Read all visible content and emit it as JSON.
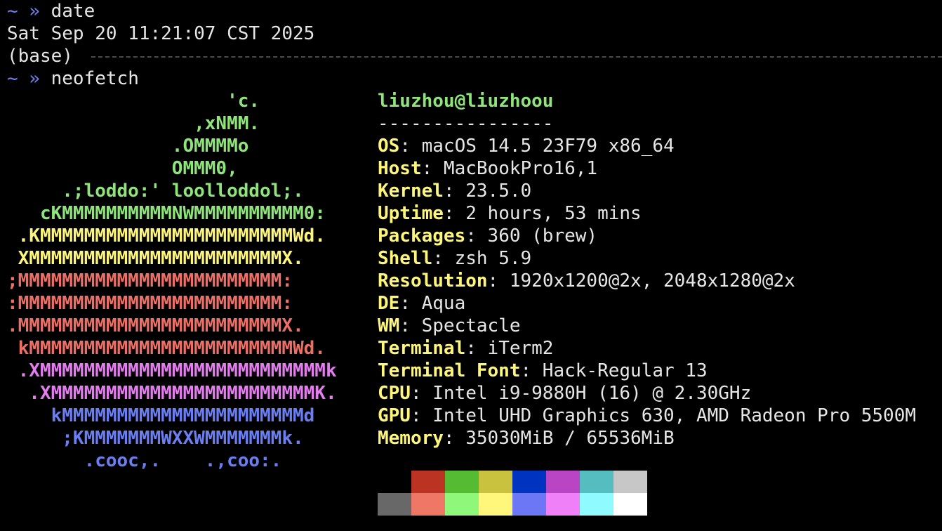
{
  "terminal": {
    "prompt_symbol": "~ »",
    "cmd1": "date",
    "date_output": "Sat Sep 20 11:21:07 CST 2025",
    "env_label": "(base)",
    "cmd2": "neofetch"
  },
  "logo_lines": [
    {
      "text": "                    'c.",
      "color": "#8ee57a"
    },
    {
      "text": "                 ,xNMM.",
      "color": "#8ee57a"
    },
    {
      "text": "               .OMMMMo",
      "color": "#8ee57a"
    },
    {
      "text": "               OMMM0,",
      "color": "#8ee57a"
    },
    {
      "text": "     .;loddo:' loolloddol;.",
      "color": "#8ee57a"
    },
    {
      "text": "   cKMMMMMMMMMMNWMMMMMMMMMM0:",
      "color": "#8ee57a"
    },
    {
      "text": " .KMMMMMMMMMMMMMMMMMMMMMMMWd.",
      "color": "#fef67b"
    },
    {
      "text": " XMMMMMMMMMMMMMMMMMMMMMMMX.",
      "color": "#fef67b"
    },
    {
      "text": ";MMMMMMMMMMMMMMMMMMMMMMMM:",
      "color": "#ee6f65"
    },
    {
      "text": ":MMMMMMMMMMMMMMMMMMMMMMMM:",
      "color": "#ee6f65"
    },
    {
      "text": ".MMMMMMMMMMMMMMMMMMMMMMMMX.",
      "color": "#ee6f65"
    },
    {
      "text": " kMMMMMMMMMMMMMMMMMMMMMMMMWd.",
      "color": "#ee6f65"
    },
    {
      "text": " .XMMMMMMMMMMMMMMMMMMMMMMMMMMk",
      "color": "#e57cf0"
    },
    {
      "text": "  .XMMMMMMMMMMMMMMMMMMMMMMMMK.",
      "color": "#e57cf0"
    },
    {
      "text": "    kMMMMMMMMMMMMMMMMMMMMMMd",
      "color": "#6b7ff5"
    },
    {
      "text": "     ;KMMMMMMMWXXWMMMMMMMk.",
      "color": "#6b7ff5"
    },
    {
      "text": "       .cooc,.    .,coo:.",
      "color": "#6b7ff5"
    }
  ],
  "user_host": "liuzhou@liuzhoou",
  "separator": "----------------",
  "info": [
    {
      "key": "OS",
      "value": "macOS 14.5 23F79 x86_64"
    },
    {
      "key": "Host",
      "value": "MacBookPro16,1"
    },
    {
      "key": "Kernel",
      "value": "23.5.0"
    },
    {
      "key": "Uptime",
      "value": "2 hours, 53 mins"
    },
    {
      "key": "Packages",
      "value": "360 (brew)"
    },
    {
      "key": "Shell",
      "value": "zsh 5.9"
    },
    {
      "key": "Resolution",
      "value": "1920x1200@2x, 2048x1280@2x"
    },
    {
      "key": "DE",
      "value": "Aqua"
    },
    {
      "key": "WM",
      "value": "Spectacle"
    },
    {
      "key": "Terminal",
      "value": "iTerm2"
    },
    {
      "key": "Terminal Font",
      "value": "Hack-Regular 13"
    },
    {
      "key": "CPU",
      "value": "Intel i9-9880H (16) @ 2.30GHz"
    },
    {
      "key": "GPU",
      "value": "Intel UHD Graphics 630, AMD Radeon Pro 5500M"
    },
    {
      "key": "Memory",
      "value": "35030MiB / 65536MiB"
    }
  ],
  "palette": {
    "normal": [
      "#000000",
      "#bb3322",
      "#55bb33",
      "#c8c23e",
      "#0033c0",
      "#b944c4",
      "#55bcc0",
      "#c7c7c7"
    ],
    "bright": [
      "#686868",
      "#ee7766",
      "#8ff77a",
      "#fff67c",
      "#6b77f5",
      "#ef80f7",
      "#8ffaff",
      "#ffffff"
    ]
  }
}
